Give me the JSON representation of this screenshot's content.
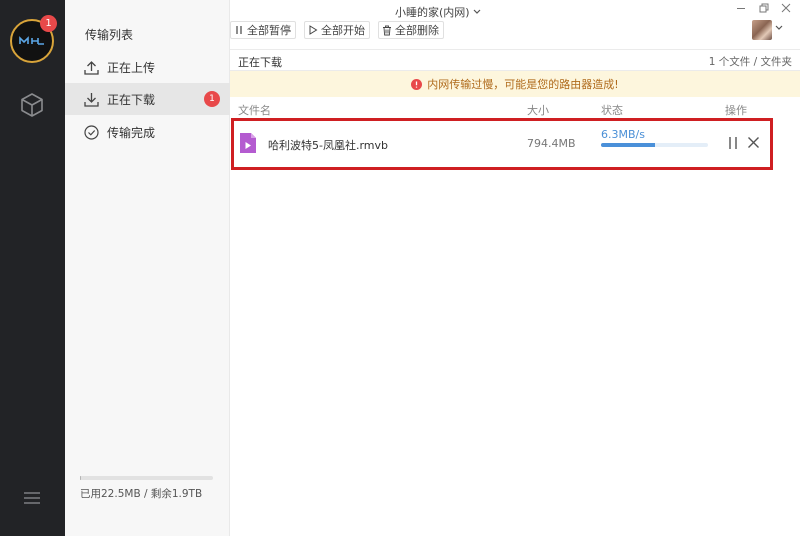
{
  "window": {
    "title": "小睡的家(内网)"
  },
  "rail": {
    "badge_count": "1"
  },
  "sidebar": {
    "title": "传输列表",
    "items": [
      {
        "label": "正在上传"
      },
      {
        "label": "正在下载",
        "badge": "1"
      },
      {
        "label": "传输完成"
      }
    ],
    "storage": {
      "text": "已用22.5MB / 剩余1.9TB",
      "used_fraction": 1e-05
    }
  },
  "toolbar": {
    "pause_all": "全部暂停",
    "start_all": "全部开始",
    "delete_all": "全部删除"
  },
  "section": {
    "title": "正在下载",
    "count": "1 个文件 / 文件夹"
  },
  "warning": {
    "text": "内网传输过慢，可能是您的路由器造成!"
  },
  "columns": {
    "name": "文件名",
    "size": "大小",
    "status": "状态",
    "ops": "操作"
  },
  "download": {
    "file_name": "哈利波特5-凤凰社.rmvb",
    "size": "794.4MB",
    "speed": "6.3MB/s",
    "progress": 0.5
  },
  "colors": {
    "accent": "#4a90d9",
    "badge": "#e8494a",
    "highlight": "#cf1f22",
    "warning_bg": "#fdf6dd",
    "warning_text": "#b06b1c",
    "file_icon": "#b45bd0"
  }
}
